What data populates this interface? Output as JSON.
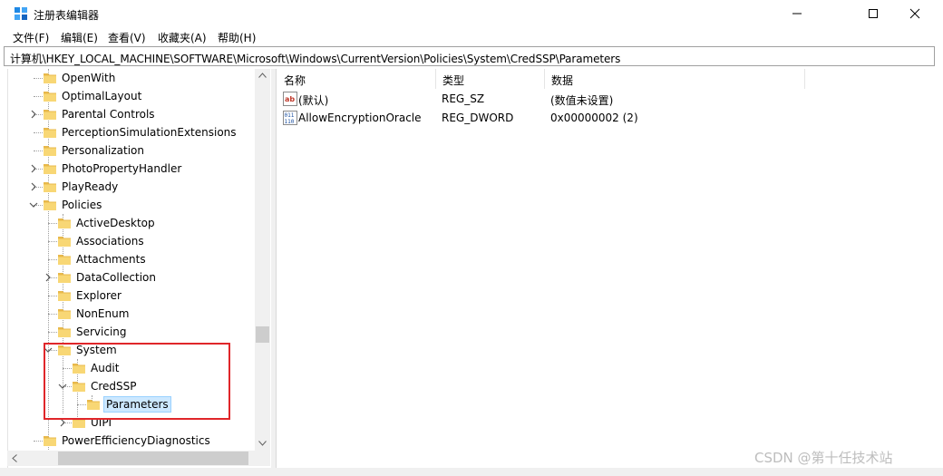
{
  "window": {
    "title": "注册表编辑器",
    "controls": [
      "minimize",
      "maximize",
      "close"
    ]
  },
  "menu": [
    "文件(F)",
    "编辑(E)",
    "查看(V)",
    "收藏夹(A)",
    "帮助(H)"
  ],
  "address": "计算机\\HKEY_LOCAL_MACHINE\\SOFTWARE\\Microsoft\\Windows\\CurrentVersion\\Policies\\System\\CredSSP\\Parameters",
  "tree": [
    {
      "label": "OpenWith",
      "expander": "none"
    },
    {
      "label": "OptimalLayout",
      "expander": "none"
    },
    {
      "label": "Parental Controls",
      "expander": "collapsed"
    },
    {
      "label": "PerceptionSimulationExtensions",
      "expander": "none"
    },
    {
      "label": "Personalization",
      "expander": "none"
    },
    {
      "label": "PhotoPropertyHandler",
      "expander": "collapsed"
    },
    {
      "label": "PlayReady",
      "expander": "collapsed"
    },
    {
      "label": "Policies",
      "expander": "expanded"
    },
    {
      "label": "ActiveDesktop",
      "expander": "none"
    },
    {
      "label": "Associations",
      "expander": "none"
    },
    {
      "label": "Attachments",
      "expander": "none"
    },
    {
      "label": "DataCollection",
      "expander": "collapsed"
    },
    {
      "label": "Explorer",
      "expander": "none"
    },
    {
      "label": "NonEnum",
      "expander": "none"
    },
    {
      "label": "Servicing",
      "expander": "none"
    },
    {
      "label": "System",
      "expander": "expanded"
    },
    {
      "label": "Audit",
      "expander": "none"
    },
    {
      "label": "CredSSP",
      "expander": "expanded"
    },
    {
      "label": "Parameters",
      "expander": "none",
      "selected": true
    },
    {
      "label": "UIPI",
      "expander": "collapsed"
    },
    {
      "label": "PowerEfficiencyDiagnostics",
      "expander": "none"
    }
  ],
  "columns": [
    "名称",
    "类型",
    "数据"
  ],
  "values": [
    {
      "name": "(默认)",
      "type": "REG_SZ",
      "data": "(数值未设置)",
      "icon": "string-value-icon"
    },
    {
      "name": "AllowEncryptionOracle",
      "type": "REG_DWORD",
      "data": "0x00000002 (2)",
      "icon": "binary-value-icon"
    }
  ],
  "watermark": "CSDN @第十任技术站",
  "colors": {
    "highlight_border": "#e0262a",
    "selection": "#cce8ff",
    "folder": "#f8d775"
  }
}
